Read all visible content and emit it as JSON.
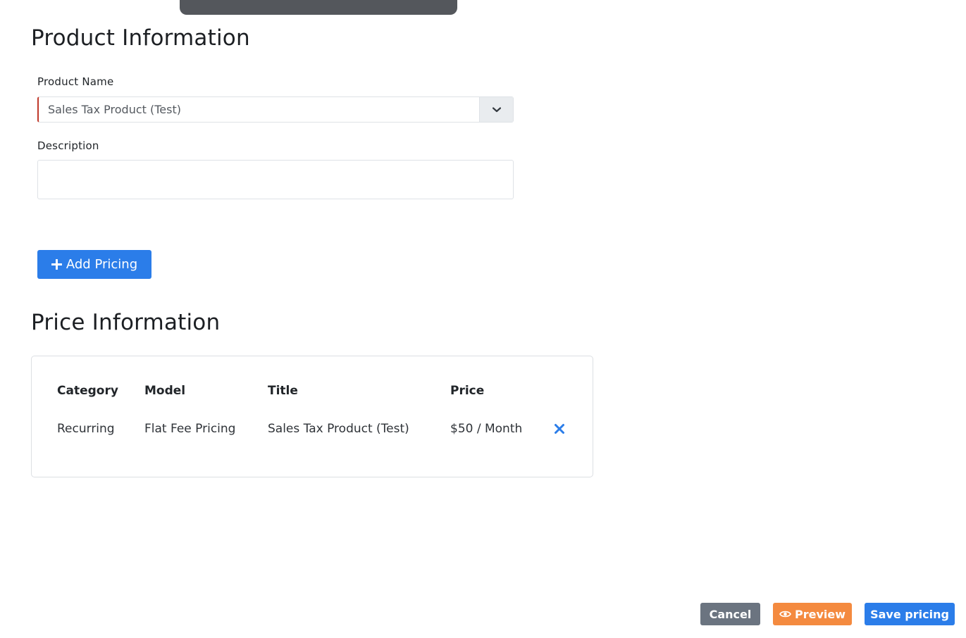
{
  "product_section": {
    "title": "Product Information",
    "product_name_label": "Product Name",
    "product_name_value": "Sales Tax Product (Test)",
    "description_label": "Description",
    "description_value": "",
    "add_pricing_label": "Add Pricing"
  },
  "price_section": {
    "title": "Price Information",
    "columns": [
      "Category",
      "Model",
      "Title",
      "Price"
    ],
    "rows": [
      {
        "category": "Recurring",
        "model": "Flat Fee Pricing",
        "title": "Sales Tax Product (Test)",
        "price": "$50 / Month"
      }
    ]
  },
  "footer": {
    "cancel_label": "Cancel",
    "preview_label": "Preview",
    "save_label": "Save pricing"
  },
  "colors": {
    "primary": "#2b7de9",
    "secondary": "#6b7480",
    "warning": "#f48a3f",
    "required_border": "#c0392b"
  },
  "icons": {
    "dropdown": "chevron-down-icon",
    "add": "plus-icon",
    "remove": "close-icon",
    "preview": "eye-icon"
  }
}
